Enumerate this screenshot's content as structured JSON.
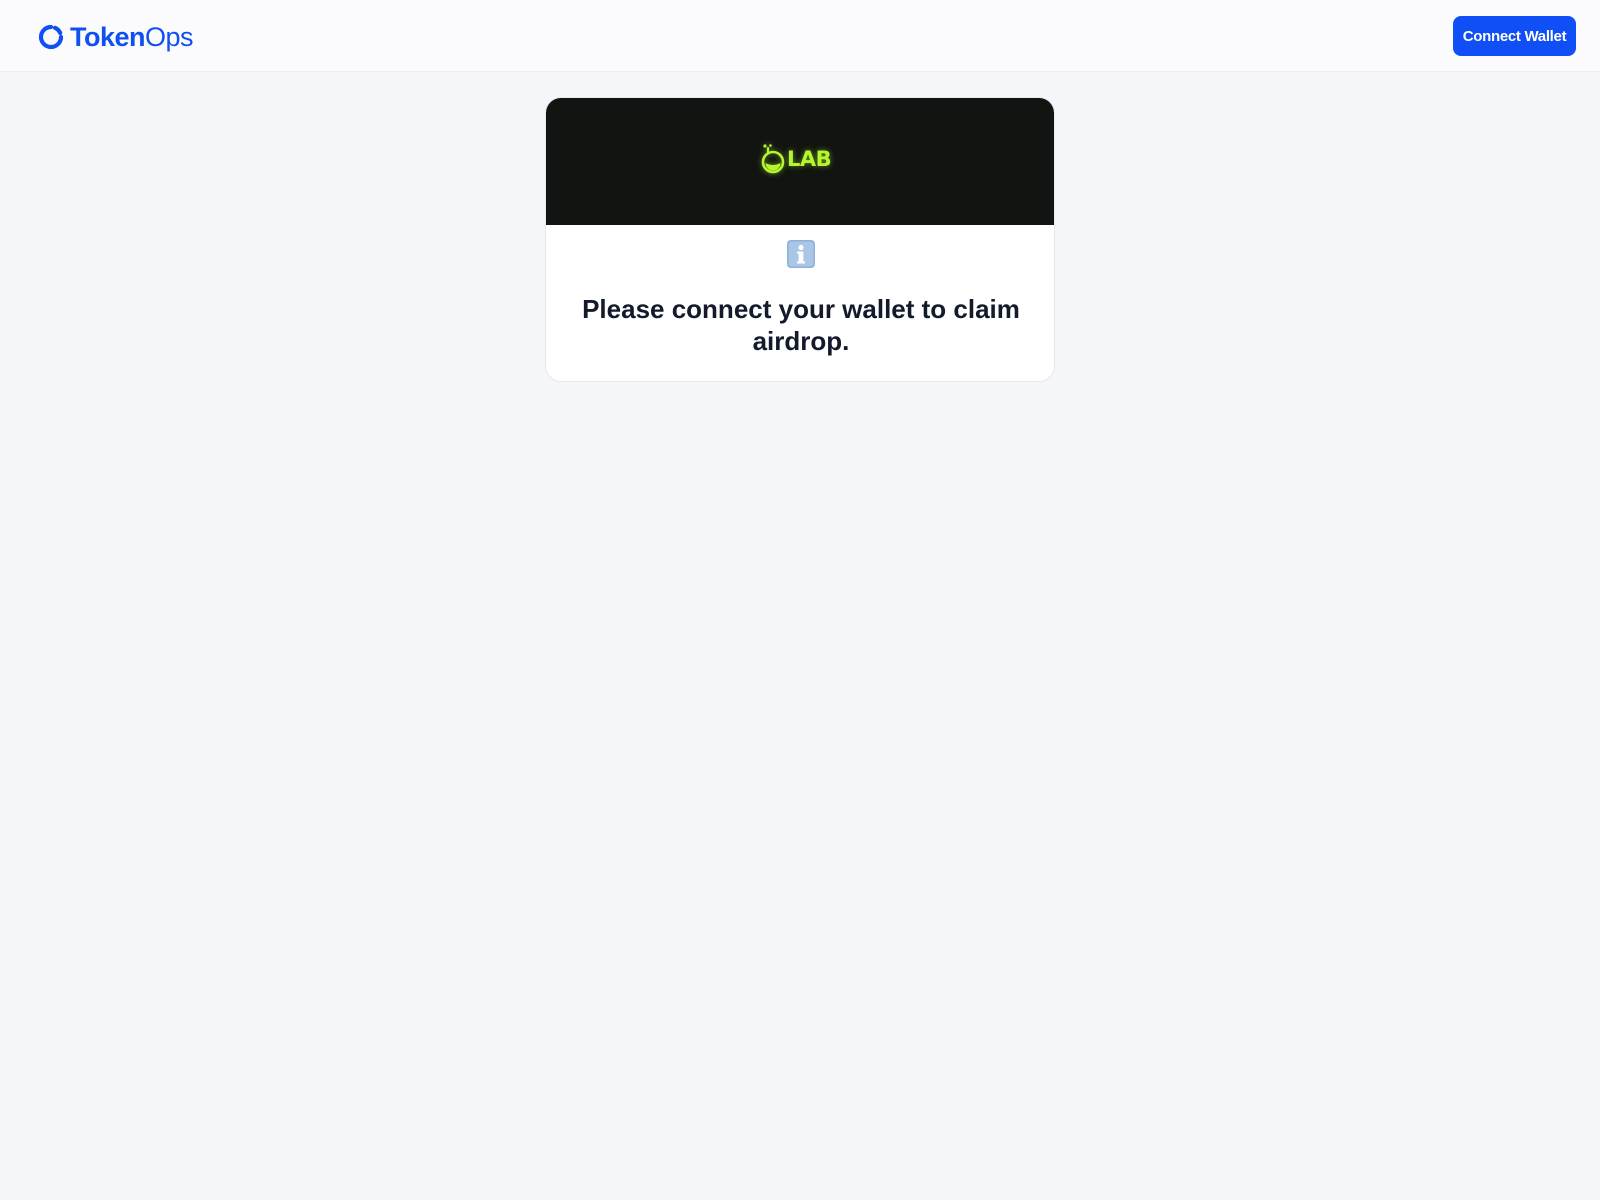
{
  "header": {
    "brand": {
      "logo_icon": "tokenops-ring-icon",
      "name_bold": "Token",
      "name_regular": "Ops",
      "color": "#1150f0"
    },
    "connect_wallet_label": "Connect Wallet",
    "connect_wallet_color": "#0f4ff5"
  },
  "card": {
    "banner": {
      "background": "#121411",
      "logo_icon": "flask-icon",
      "logo_text": "LAB",
      "logo_color": "#b7f52e"
    },
    "status_icon": "info-icon",
    "message": "Please connect your wallet to claim airdrop."
  }
}
